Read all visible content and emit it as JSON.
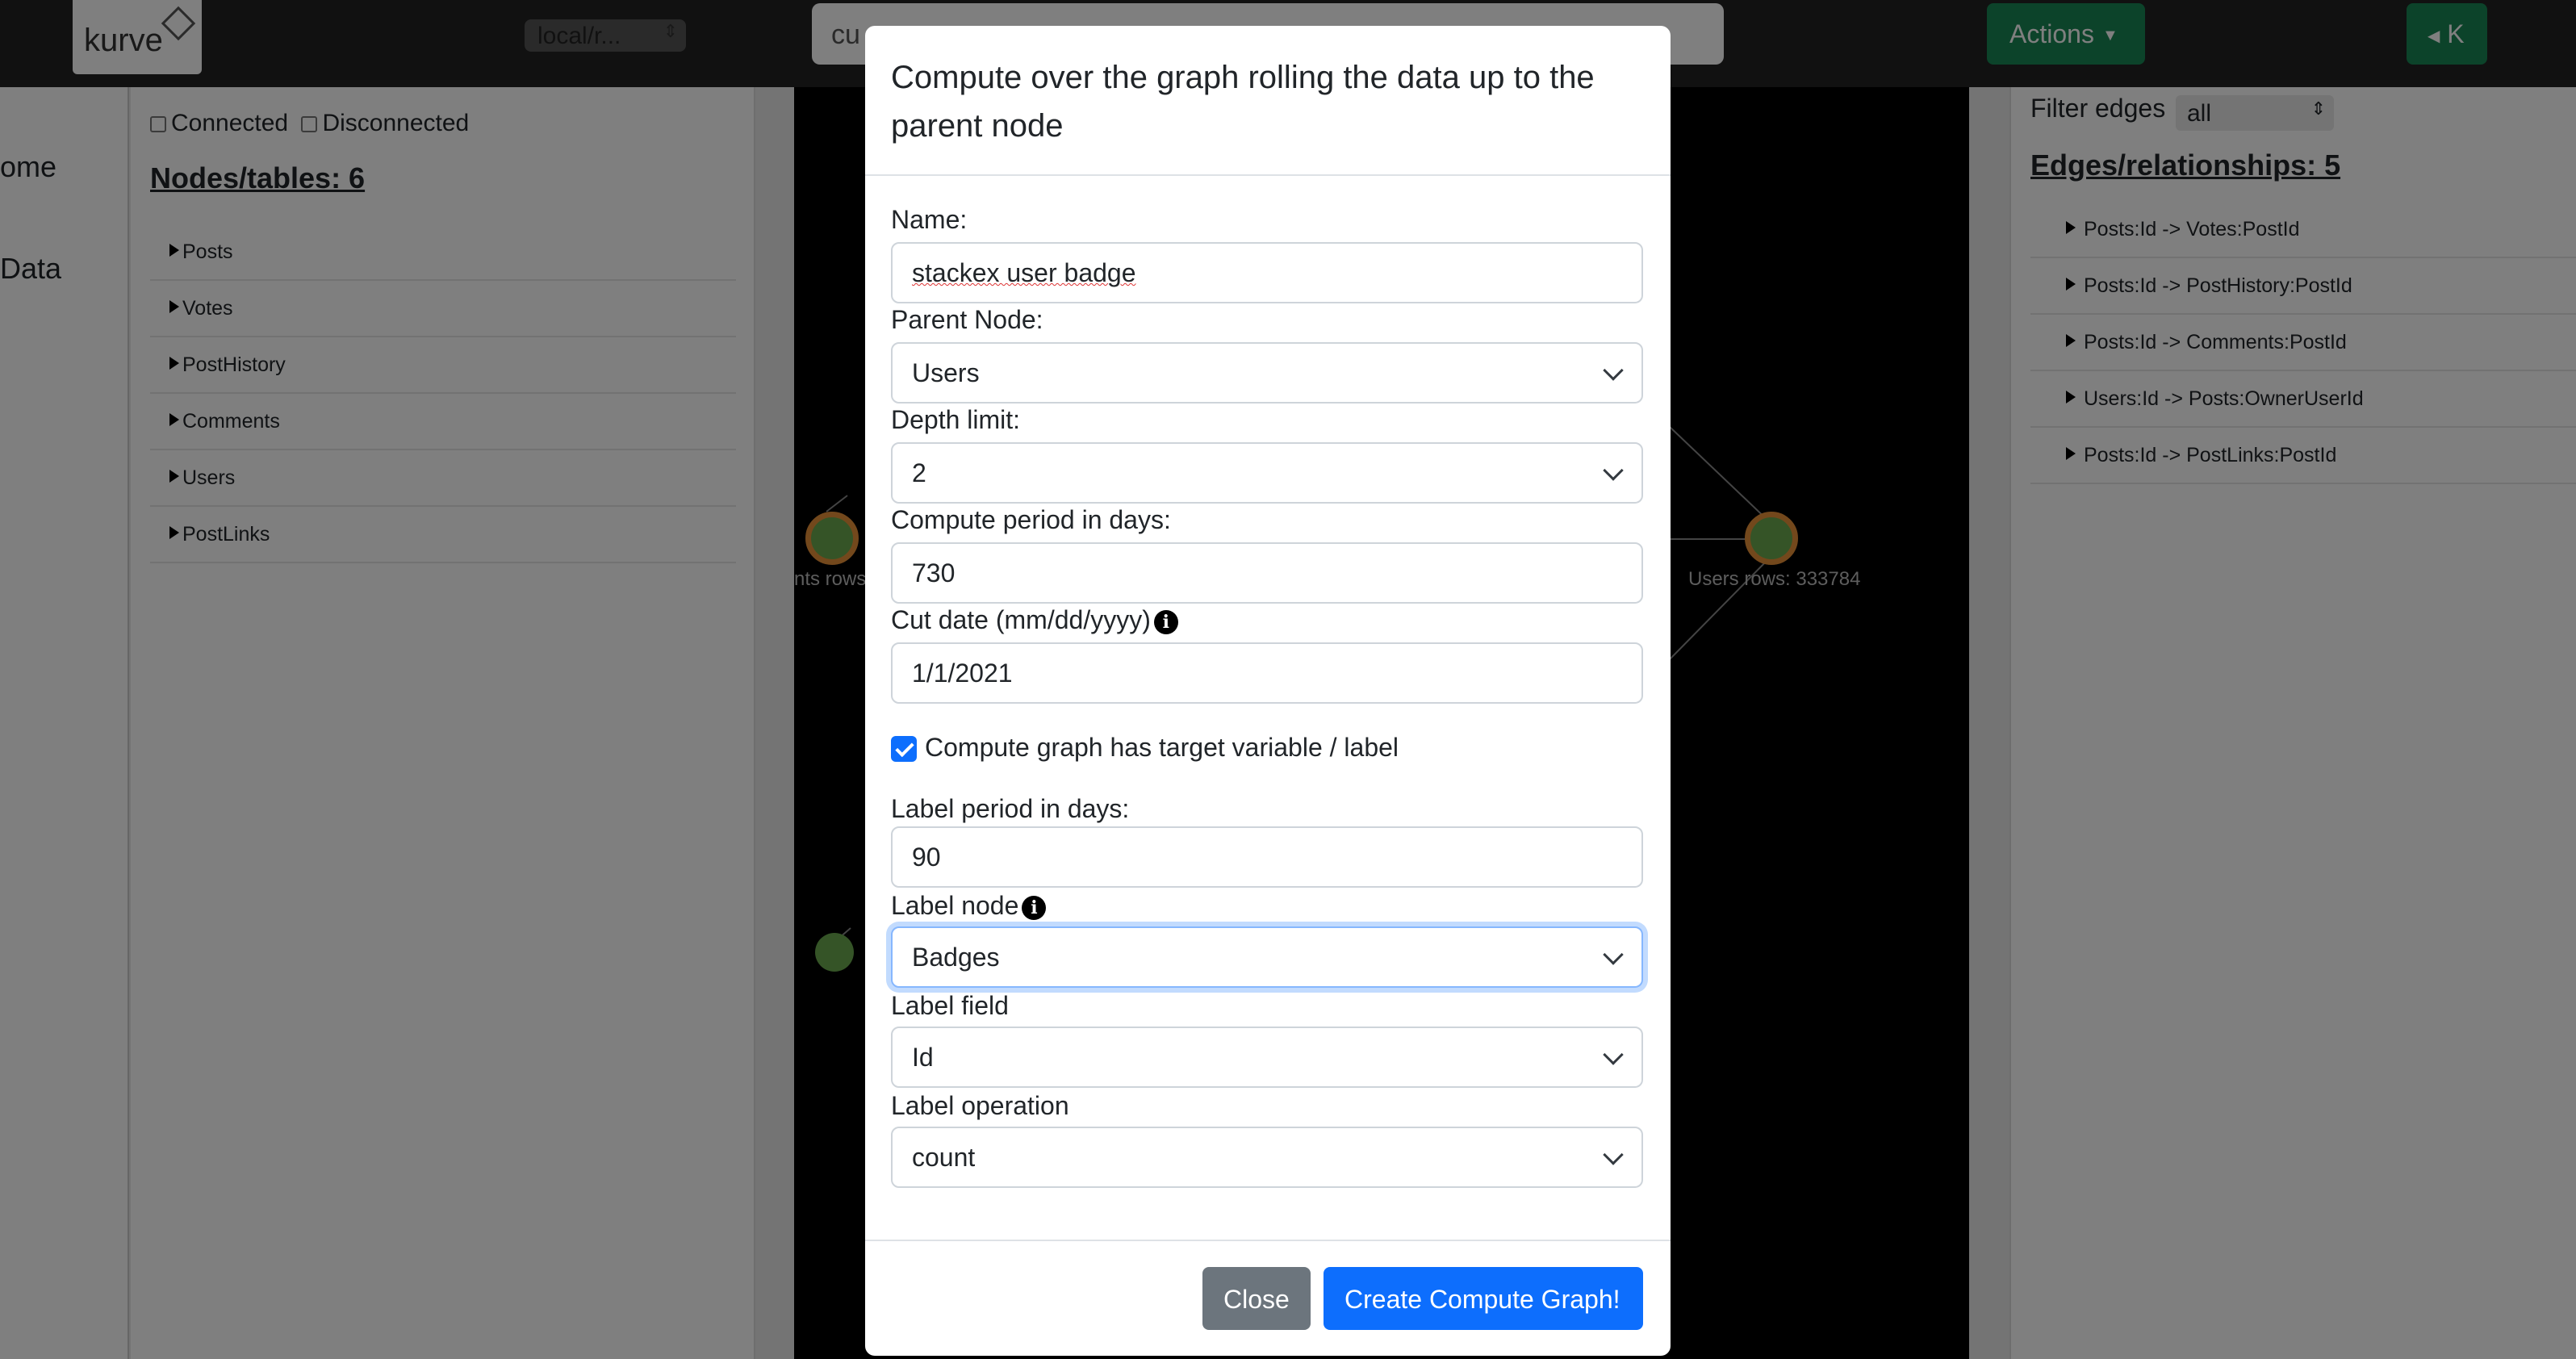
{
  "topbar": {
    "logo_text": "kurve",
    "db_select_value": "local/r...",
    "search_value": "cu",
    "actions_label": "Actions",
    "collapse_label": "K"
  },
  "left_nav": {
    "home_label": "ome",
    "data_label": "Data"
  },
  "nodes_panel": {
    "connected_label": "Connected",
    "disconnected_label": "Disconnected",
    "title": "Nodes/tables: 6",
    "items": [
      {
        "label": "Posts"
      },
      {
        "label": "Votes"
      },
      {
        "label": "PostHistory"
      },
      {
        "label": "Comments"
      },
      {
        "label": "Users"
      },
      {
        "label": "PostLinks"
      }
    ]
  },
  "graph": {
    "left_node_label": "nts rows",
    "users_node_label": "Users rows: 333784"
  },
  "edges_panel": {
    "filter_label": "Filter edges",
    "filter_value": "all",
    "title": "Edges/relationships: 5",
    "items": [
      {
        "label": "Posts:Id -> Votes:PostId"
      },
      {
        "label": "Posts:Id -> PostHistory:PostId"
      },
      {
        "label": "Posts:Id -> Comments:PostId"
      },
      {
        "label": "Users:Id -> Posts:OwnerUserId"
      },
      {
        "label": "Posts:Id -> PostLinks:PostId"
      }
    ]
  },
  "modal": {
    "title": "Compute over the graph rolling the data up to the parent node",
    "name": {
      "label": "Name:",
      "value": "stackex user badge"
    },
    "parent_node": {
      "label": "Parent Node:",
      "value": "Users"
    },
    "depth_limit": {
      "label": "Depth limit:",
      "value": "2"
    },
    "compute_period": {
      "label": "Compute period in days:",
      "value": "730"
    },
    "cut_date": {
      "label": "Cut date (mm/dd/yyyy)",
      "value": "1/1/2021"
    },
    "has_target": {
      "label": "Compute graph has target variable / label",
      "checked": true
    },
    "label_period": {
      "label": "Label period in days:",
      "value": "90"
    },
    "label_node": {
      "label": "Label node",
      "value": "Badges"
    },
    "label_field": {
      "label": "Label field",
      "value": "Id"
    },
    "label_operation": {
      "label": "Label operation",
      "value": "count"
    },
    "close_label": "Close",
    "create_label": "Create Compute Graph!"
  }
}
